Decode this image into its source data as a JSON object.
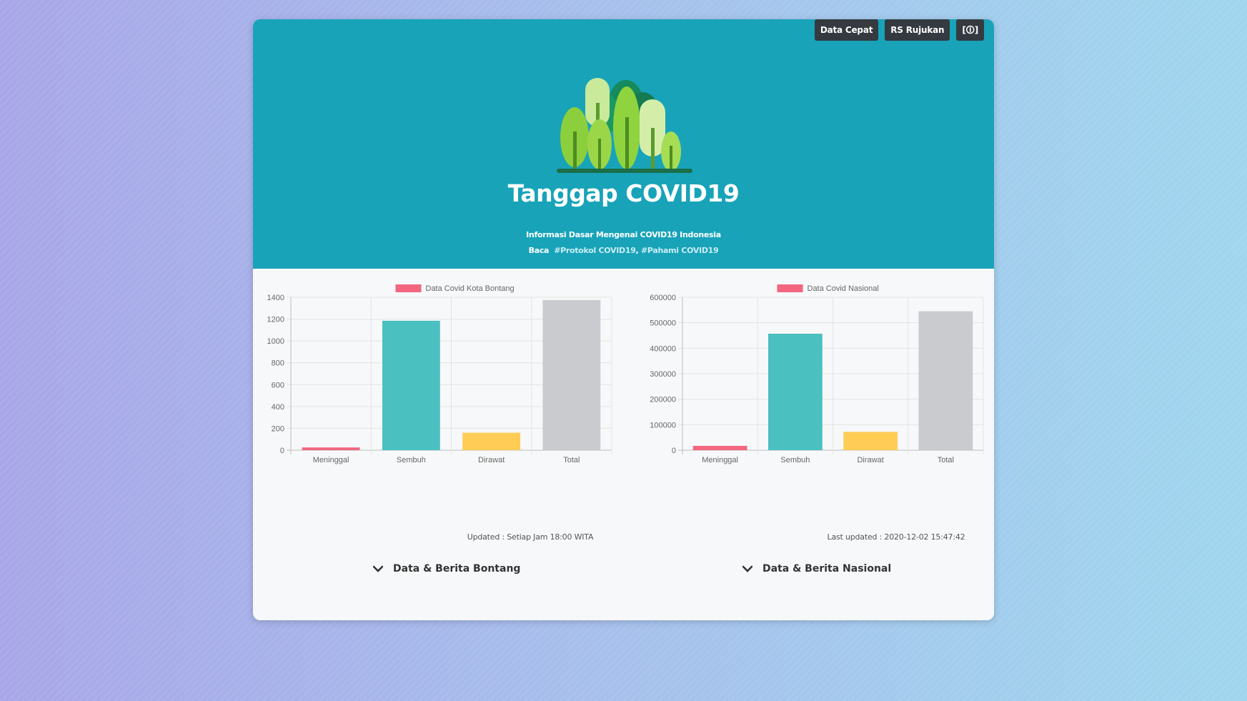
{
  "header": {
    "buttons": [
      "Data Cepat",
      "RS Rujukan",
      "[🛈]"
    ],
    "title": "Tanggap COVID19",
    "subtitle": "Informasi Dasar Mengenai COVID19 Indonesia",
    "links_prefix": "Baca",
    "links": [
      "#Protokol COVID19",
      "#Pahami COVID19"
    ],
    "logo_icon": "forest-trees-icon"
  },
  "colors": {
    "hero": "#18a3b9",
    "meninggal": "#f26680",
    "sembuh": "#4bc0c0",
    "dirawat": "#ffcd56",
    "total": "#c9cbcf"
  },
  "chart_data": [
    {
      "type": "bar",
      "legend": "Data Covid Kota Bontang",
      "categories": [
        "Meninggal",
        "Sembuh",
        "Dirawat",
        "Total"
      ],
      "values": [
        25,
        1185,
        160,
        1375
      ],
      "ylim": [
        0,
        1400
      ],
      "yticks": [
        0,
        200,
        400,
        600,
        800,
        1000,
        1200,
        1400
      ],
      "grid": true,
      "legend_position": "top"
    },
    {
      "type": "bar",
      "legend": "Data Covid Nasional",
      "categories": [
        "Meninggal",
        "Sembuh",
        "Dirawat",
        "Total"
      ],
      "values": [
        17000,
        457000,
        72000,
        545000
      ],
      "ylim": [
        0,
        600000
      ],
      "yticks": [
        0,
        100000,
        200000,
        300000,
        400000,
        500000,
        600000
      ],
      "grid": true,
      "legend_position": "top"
    }
  ],
  "sections": {
    "left": {
      "updated": "Updated : Setiap Jam 18:00 WITA",
      "collapse_label": "Data & Berita Bontang"
    },
    "right": {
      "updated": "Last updated : 2020-12-02 15:47:42",
      "collapse_label": "Data & Berita Nasional"
    }
  }
}
